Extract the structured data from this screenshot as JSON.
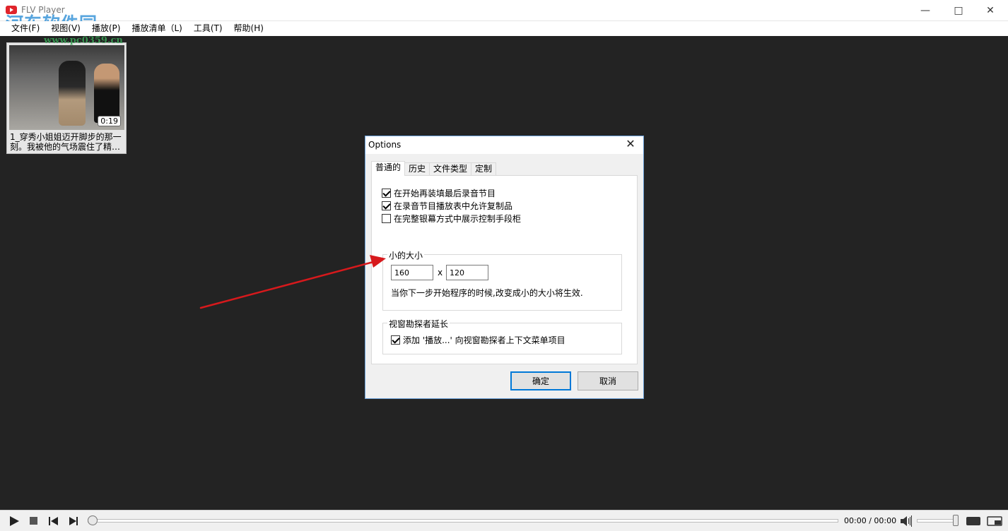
{
  "window": {
    "title": "FLV Player",
    "watermark": "河东软件园",
    "watermark_url": "www.pc0359.cn"
  },
  "menubar": [
    {
      "label": "文件(F)"
    },
    {
      "label": "视图(V)"
    },
    {
      "label": "播放(P)"
    },
    {
      "label": "播放清单（L)"
    },
    {
      "label": "工具(T)"
    },
    {
      "label": "帮助(H)"
    }
  ],
  "playlist": {
    "items": [
      {
        "title": "1_穿秀小姐姐迈开脚步的那一刻。我被他的气场震住了精…",
        "duration": "0:19"
      }
    ]
  },
  "dialog": {
    "title": "Options",
    "tabs": [
      {
        "label": "普通的",
        "active": true
      },
      {
        "label": "历史",
        "active": false
      },
      {
        "label": "文件类型",
        "active": false
      },
      {
        "label": "定制",
        "active": false
      }
    ],
    "checkboxes": [
      {
        "label": "在开始再装填最后录音节目",
        "checked": true
      },
      {
        "label": "在录音节目播放表中允许复制品",
        "checked": true
      },
      {
        "label": "在完整银幕方式中展示控制手段柜",
        "checked": false
      }
    ],
    "size_group": {
      "legend": "小的大小",
      "width_value": "160",
      "separator": "x",
      "height_value": "120",
      "note": "当你下一步开始程序的时候,改变成小的大小将生效."
    },
    "explorer_group": {
      "legend": "视窗勘探者延长",
      "checkbox_label": "添加 '播放...' 向视窗勘探者上下文菜单项目",
      "checked": true
    },
    "ok_label": "确定",
    "cancel_label": "取消"
  },
  "player": {
    "time": "00:00 / 00:00",
    "progress": 0,
    "volume": 0.9
  },
  "colors": {
    "background": "#232323",
    "accent": "#0078d7",
    "annotation_arrow": "#d7191c"
  }
}
